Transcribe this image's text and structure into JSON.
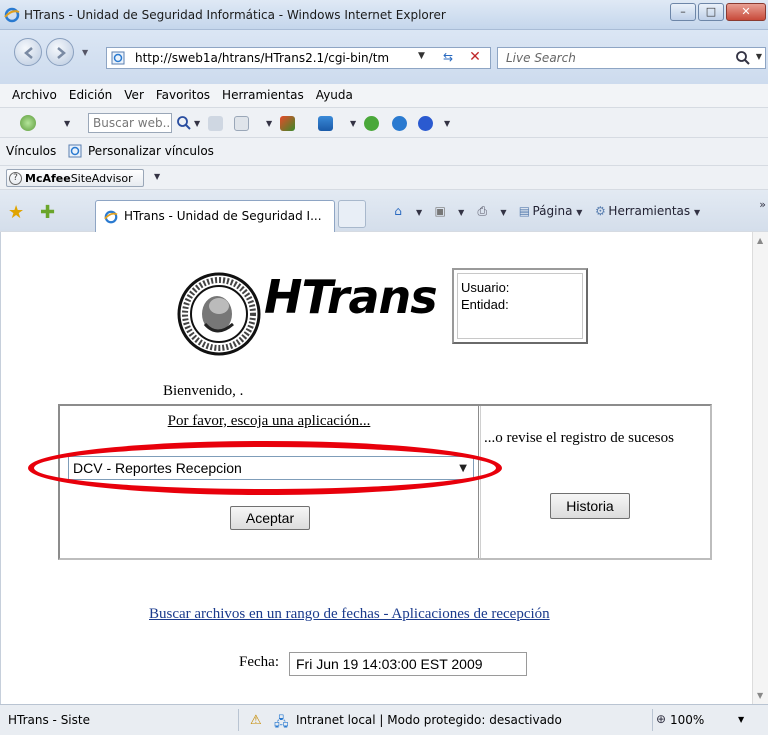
{
  "window": {
    "title": "HTrans - Unidad de Seguridad Informática - Windows Internet Explorer",
    "minimize": "–",
    "maximize": "□",
    "close": "✕"
  },
  "address_bar": {
    "url": "http://sweb1a/htrans/HTrans2.1/cgi-bin/tm",
    "search_placeholder": "Live Search"
  },
  "menu": [
    "Archivo",
    "Edición",
    "Ver",
    "Favoritos",
    "Herramientas",
    "Ayuda"
  ],
  "toolbar": {
    "search_placeholder": "Buscar web.."
  },
  "links_bar": {
    "label": "Vínculos",
    "customize": "Personalizar vínculos"
  },
  "siteadvisor": {
    "brand": "McAfee",
    "product": "SiteAdvisor"
  },
  "tabs": [
    {
      "label": "HTrans - Unidad de Seguridad I..."
    }
  ],
  "command_bar": {
    "page": "Página",
    "tools": "Herramientas",
    "more": "»"
  },
  "page": {
    "logo": "HTrans",
    "user_label": "Usuario:",
    "entity_label": "Entidad:",
    "welcome": "Bienvenido, .",
    "prompt": "Por favor, escoja una aplicación...",
    "selected_application": "DCV - Reportes Recepcion",
    "accept_button": "Aceptar",
    "review_text": "...o revise el registro de sucesos",
    "history_button": "Historia",
    "range_link": "Buscar archivos en un rango de fechas - Aplicaciones de recepción",
    "date_label": "Fecha:",
    "date_value": "Fri Jun 19 14:03:00 EST 2009"
  },
  "status_bar": {
    "text": "HTrans - Siste",
    "zone": "Intranet local | Modo protegido: desactivado",
    "zoom": "100%"
  },
  "colors": {
    "highlight": "#e8000b",
    "link": "#1a3a8c"
  }
}
